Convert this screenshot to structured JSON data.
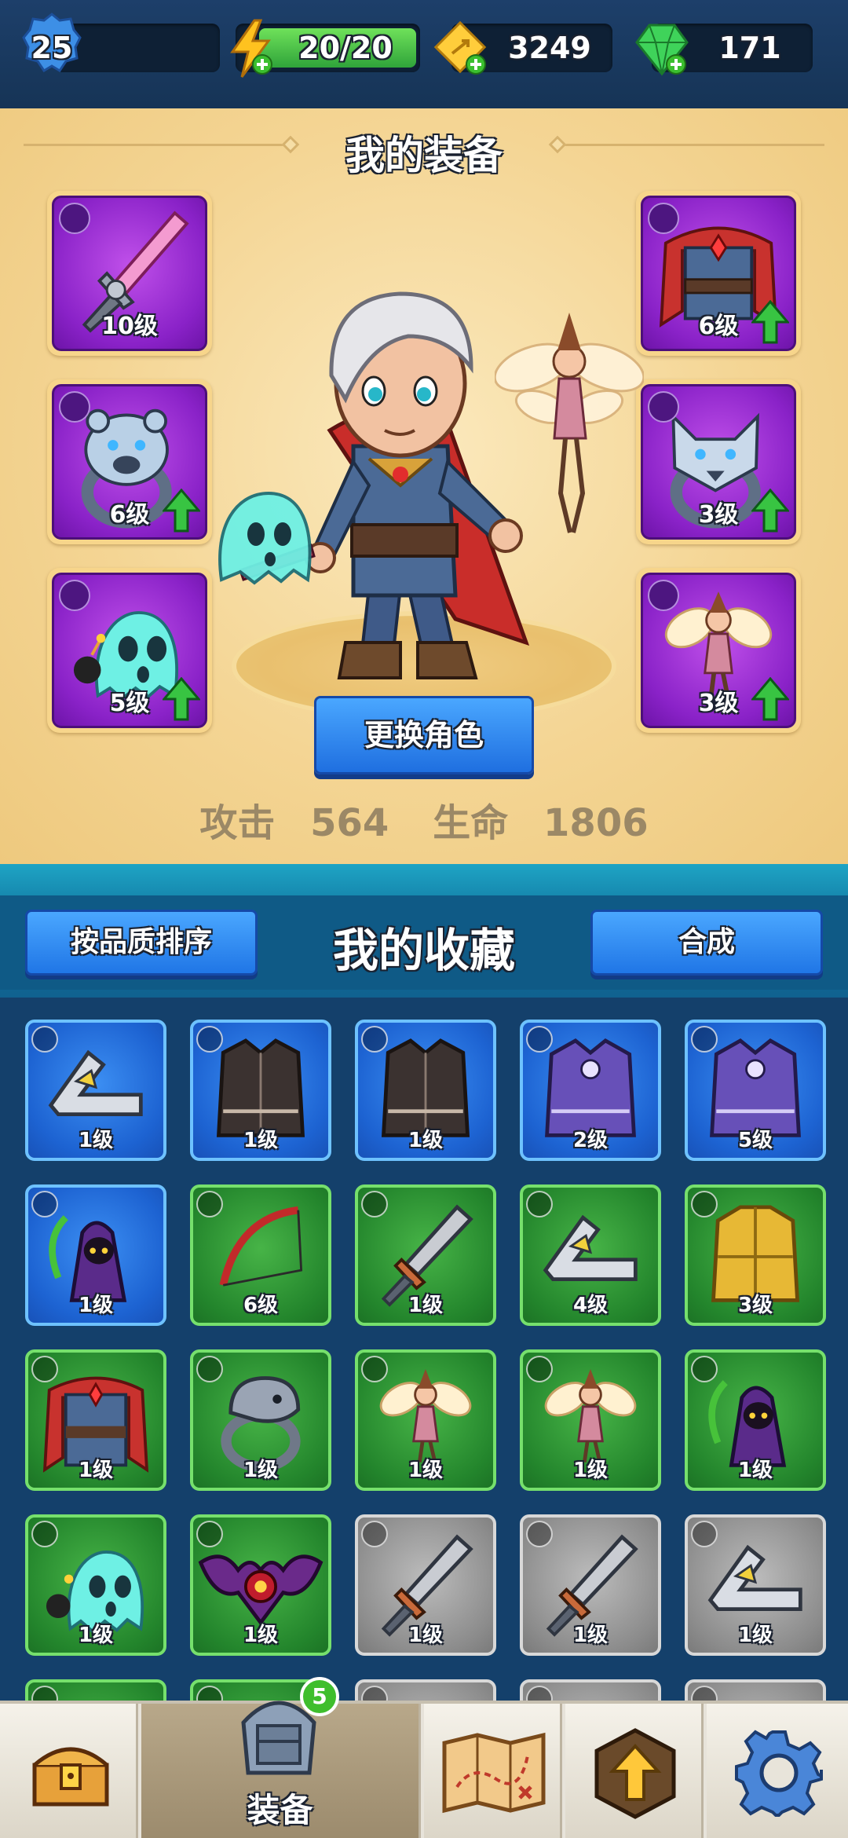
{
  "topbar": {
    "level": "25",
    "energy": "20/20",
    "gold": "3249",
    "gems": "171"
  },
  "equipment": {
    "title": "我的装备",
    "left_slots": [
      {
        "type": "bow-icon",
        "item": "sword-icon",
        "level": "10级",
        "upgrade": false
      },
      {
        "type": "ring-icon",
        "item": "bear-ring-icon",
        "level": "6级",
        "upgrade": true
      },
      {
        "type": "pet-icon",
        "item": "ghost-pet-icon",
        "level": "5级",
        "upgrade": true
      }
    ],
    "right_slots": [
      {
        "type": "armor-icon",
        "item": "cape-armor-icon",
        "level": "6级",
        "upgrade": true
      },
      {
        "type": "ring-icon",
        "item": "wolf-ring-icon",
        "level": "3级",
        "upgrade": true
      },
      {
        "type": "pet-icon",
        "item": "fairy-pet-icon",
        "level": "3级",
        "upgrade": true
      }
    ],
    "change_button": "更换角色",
    "attack_label": "攻击",
    "attack_value": "564",
    "hp_label": "生命",
    "hp_value": "1806"
  },
  "collection": {
    "sort_button": "按品质排序",
    "title": "我的收藏",
    "merge_button": "合成",
    "rows": [
      [
        {
          "rarity": "blue",
          "type": "bow-icon",
          "item": "boomerang-icon",
          "level": "1级"
        },
        {
          "rarity": "blue",
          "type": "armor-icon",
          "item": "dark-vest-icon",
          "level": "1级"
        },
        {
          "rarity": "blue",
          "type": "armor-icon",
          "item": "dark-vest-icon",
          "level": "1级"
        },
        {
          "rarity": "blue",
          "type": "armor-icon",
          "item": "purple-vest-icon",
          "level": "2级"
        },
        {
          "rarity": "blue",
          "type": "armor-icon",
          "item": "purple-vest-icon",
          "level": "5级"
        }
      ],
      [
        {
          "rarity": "blue",
          "type": "pet-icon",
          "item": "reaper-pet-icon",
          "level": "1级"
        },
        {
          "rarity": "green",
          "type": "bow-icon",
          "item": "red-bow-icon",
          "level": "6级"
        },
        {
          "rarity": "green",
          "type": "bow-icon",
          "item": "saw-sword-icon",
          "level": "1级"
        },
        {
          "rarity": "green",
          "type": "bow-icon",
          "item": "boomerang-icon",
          "level": "4级"
        },
        {
          "rarity": "green",
          "type": "armor-icon",
          "item": "gold-armor-icon",
          "level": "3级"
        }
      ],
      [
        {
          "rarity": "green",
          "type": "armor-icon",
          "item": "cape-armor-icon",
          "level": "1级"
        },
        {
          "rarity": "green",
          "type": "ring-icon",
          "item": "snake-ring-icon",
          "level": "1级"
        },
        {
          "rarity": "green",
          "type": "pet-icon",
          "item": "fairy-pet-icon",
          "level": "1级"
        },
        {
          "rarity": "green",
          "type": "pet-icon",
          "item": "fairy-pet-icon",
          "level": "1级"
        },
        {
          "rarity": "green",
          "type": "pet-icon",
          "item": "reaper-pet-icon",
          "level": "1级"
        }
      ],
      [
        {
          "rarity": "green",
          "type": "pet-icon",
          "item": "ghost-pet-icon",
          "level": "1级"
        },
        {
          "rarity": "green",
          "type": "pet-icon",
          "item": "bat-pet-icon",
          "level": "1级"
        },
        {
          "rarity": "gray",
          "type": "bow-icon",
          "item": "saw-sword-icon",
          "level": "1级"
        },
        {
          "rarity": "gray",
          "type": "bow-icon",
          "item": "saw-sword-icon",
          "level": "1级"
        },
        {
          "rarity": "gray",
          "type": "bow-icon",
          "item": "boomerang-icon",
          "level": "1级"
        }
      ]
    ]
  },
  "nav": {
    "active_label": "装备",
    "equipment_badge": "5",
    "tabs": [
      "chest-icon",
      "helmet-armor-icon",
      "map-icon",
      "upgrade-icon",
      "settings-gear-icon"
    ]
  },
  "colors": {
    "rarity_blue": "#1d63d2",
    "rarity_green": "#23852c",
    "rarity_gray": "#8c8c8c",
    "slot_purple": "#8a22c8",
    "button_blue": "#2076e6"
  }
}
